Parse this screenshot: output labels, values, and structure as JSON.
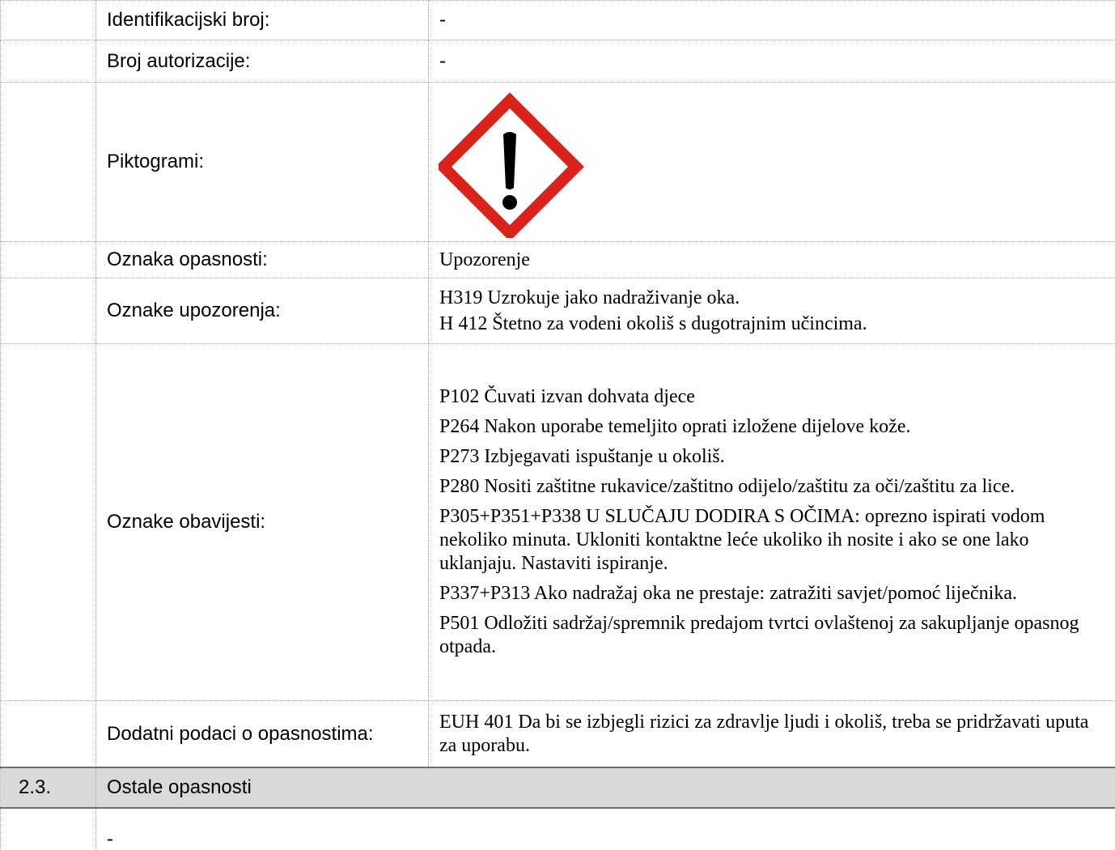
{
  "rows": {
    "identification": {
      "label": "Identifikacijski broj:",
      "value": "-"
    },
    "authorization": {
      "label": "Broj autorizacije:",
      "value": "-"
    },
    "pictograms": {
      "label": "Piktogrami:",
      "icon": "exclamation-mark-hazard-icon",
      "border_color": "#d9221b"
    },
    "signal_word": {
      "label": "Oznaka opasnosti:",
      "value": "Upozorenje"
    },
    "hazard_statements": {
      "label": "Oznake upozorenja:",
      "lines": [
        "H319 Uzrokuje jako nadraživanje oka.",
        "H 412 Štetno za vodeni okoliš s dugotrajnim učincima."
      ]
    },
    "precautionary_statements": {
      "label": "Oznake obavijesti:",
      "lines": [
        "P102 Čuvati izvan dohvata djece",
        "P264 Nakon uporabe temeljito oprati izložene dijelove kože.",
        "P273 Izbjegavati ispuštanje u okoliš.",
        "P280 Nositi zaštitne rukavice/zaštitno odijelo/zaštitu za oči/zaštitu za lice.",
        "P305+P351+P338 U SLUČAJU DODIRA S OČIMA: oprezno ispirati vodom nekoliko minuta. Ukloniti kontaktne leće ukoliko ih nosite i ako se one lako uklanjaju. Nastaviti ispiranje.",
        "P337+P313 Ako nadražaj oka ne prestaje: zatražiti savjet/pomoć liječnika.",
        "P501 Odložiti sadržaj/spremnik predajom tvrtci ovlaštenoj za sakupljanje opasnog otpada."
      ]
    },
    "supplemental_hazard": {
      "label": "Dodatni podaci o opasnostima:",
      "value": "EUH 401 Da bi se izbjegli rizici za zdravlje ljudi i okoliš, treba se pridržavati uputa za uporabu."
    }
  },
  "section": {
    "number": "2.3.",
    "title": "Ostale opasnosti",
    "background": "#d9d9d9"
  },
  "other_hazards": {
    "value": "-"
  }
}
